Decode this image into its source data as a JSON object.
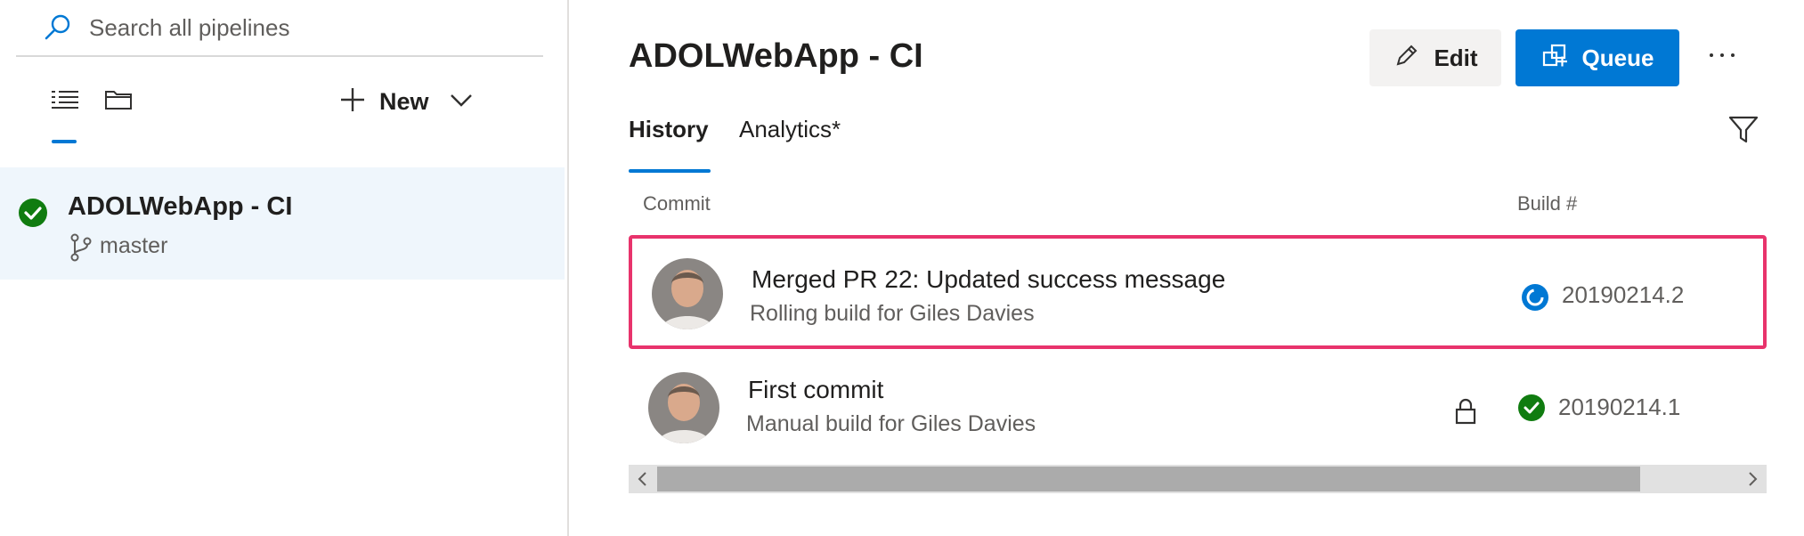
{
  "left_pane": {
    "search_placeholder": "Search all pipelines",
    "new_label": "New",
    "pipelines": [
      {
        "name": "ADOLWebApp - CI",
        "branch": "master",
        "status": "succeeded"
      }
    ]
  },
  "main": {
    "title": "ADOLWebApp - CI",
    "edit_label": "Edit",
    "queue_label": "Queue",
    "tabs": [
      {
        "label": "History",
        "active": true
      },
      {
        "label": "Analytics*",
        "active": false
      }
    ],
    "columns": {
      "commit": "Commit",
      "build": "Build #"
    },
    "builds": [
      {
        "title": "Merged PR 22: Updated success message",
        "subtitle": "Rolling build for Giles Davies",
        "build_number": "20190214.2",
        "status": "in-progress",
        "locked": false,
        "highlighted": true
      },
      {
        "title": "First commit",
        "subtitle": "Manual build for Giles Davies",
        "build_number": "20190214.1",
        "status": "succeeded",
        "locked": true,
        "highlighted": false
      }
    ]
  },
  "colors": {
    "accent": "#0078d4",
    "success": "#107c10",
    "highlight": "#e8336c",
    "selected_bg": "#eff6fc"
  },
  "icons": {
    "search": "search-icon",
    "list_view": "list-view-icon",
    "folder_view": "folder-icon",
    "add": "plus-icon",
    "chevron": "chevron-down-icon",
    "branch": "branch-icon",
    "edit": "pencil-icon",
    "queue": "queue-icon",
    "more": "more-icon",
    "filter": "filter-icon",
    "lock": "lock-icon"
  }
}
